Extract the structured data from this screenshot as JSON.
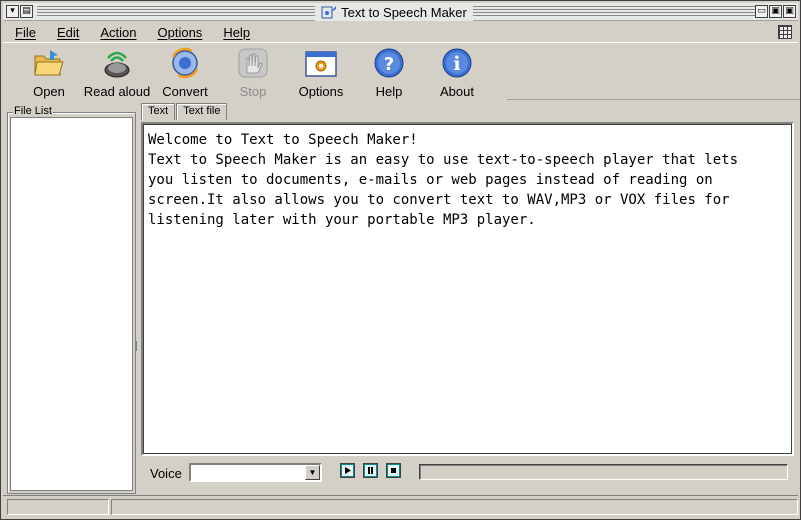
{
  "window": {
    "title": "Text to Speech Maker"
  },
  "menu": [
    {
      "label": "File"
    },
    {
      "label": "Edit"
    },
    {
      "label": "Action"
    },
    {
      "label": "Options"
    },
    {
      "label": "Help"
    }
  ],
  "toolbar": [
    {
      "label": "Open",
      "icon": "folder-open-icon",
      "enabled": true
    },
    {
      "label": "Read aloud",
      "icon": "speaker-icon",
      "enabled": true
    },
    {
      "label": "Convert",
      "icon": "convert-icon",
      "enabled": true
    },
    {
      "label": "Stop",
      "icon": "stop-hand-icon",
      "enabled": false
    },
    {
      "label": "Options",
      "icon": "options-window-icon",
      "enabled": true
    },
    {
      "label": "Help",
      "icon": "help-icon",
      "enabled": true
    },
    {
      "label": "About",
      "icon": "info-icon",
      "enabled": true
    }
  ],
  "filelist": {
    "legend": "File List"
  },
  "tabs": [
    {
      "label": "Text",
      "active": true
    },
    {
      "label": "Text file",
      "active": false
    }
  ],
  "editor": {
    "content": "Welcome to Text to Speech Maker!\nText to Speech Maker is an easy to use text-to-speech player that lets\nyou listen to documents, e-mails or web pages instead of reading on\nscreen.It also allows you to convert text to WAV,MP3 or VOX files for\nlistening later with your portable MP3 player."
  },
  "voice": {
    "label": "Voice",
    "selected": ""
  },
  "colors": {
    "window_bg": "#d4d0c8",
    "accent_teal": "#0a8a8a",
    "icon_blue": "#3b6fd1"
  }
}
